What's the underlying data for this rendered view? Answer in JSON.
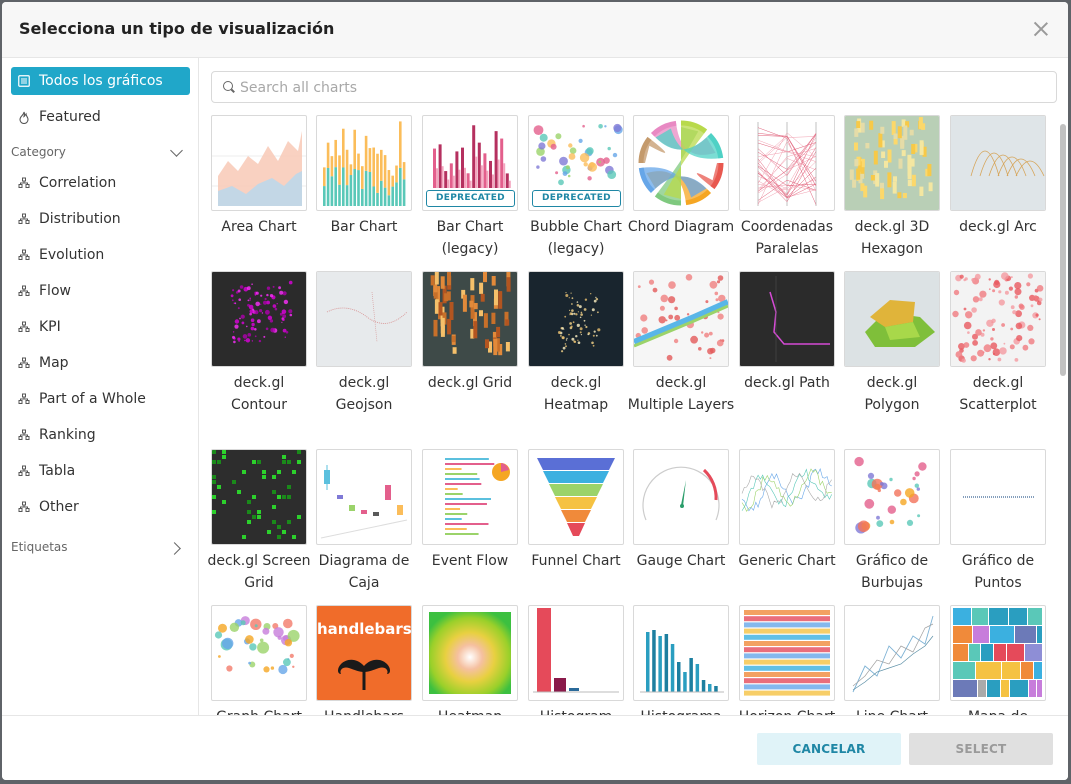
{
  "modal": {
    "title": "Selecciona un tipo de visualización"
  },
  "sidebar": {
    "top_items": [
      {
        "label": "Todos los gráficos",
        "active": true,
        "icon": "list-icon"
      },
      {
        "label": "Featured",
        "active": false,
        "icon": "fire-icon"
      }
    ],
    "category_label": "Category",
    "categories": [
      "Correlation",
      "Distribution",
      "Evolution",
      "Flow",
      "KPI",
      "Map",
      "Part of a Whole",
      "Ranking",
      "Tabla",
      "Other"
    ],
    "tags_label": "Etiquetas"
  },
  "search": {
    "placeholder": "Search all charts",
    "value": ""
  },
  "charts": [
    {
      "label": "Area Chart"
    },
    {
      "label": "Bar Chart"
    },
    {
      "label": "Bar Chart (legacy)",
      "badge": "DEPRECATED"
    },
    {
      "label": "Bubble Chart (legacy)",
      "badge": "DEPRECATED"
    },
    {
      "label": "Chord Diagram"
    },
    {
      "label": "Coordenadas Paralelas"
    },
    {
      "label": "deck.gl 3D Hexagon"
    },
    {
      "label": "deck.gl Arc"
    },
    {
      "label": "deck.gl Contour"
    },
    {
      "label": "deck.gl Geojson"
    },
    {
      "label": "deck.gl Grid"
    },
    {
      "label": "deck.gl Heatmap"
    },
    {
      "label": "deck.gl Multiple Layers"
    },
    {
      "label": "deck.gl Path"
    },
    {
      "label": "deck.gl Polygon"
    },
    {
      "label": "deck.gl Scatterplot"
    },
    {
      "label": "deck.gl Screen Grid"
    },
    {
      "label": "Diagrama de Caja"
    },
    {
      "label": "Event Flow"
    },
    {
      "label": "Funnel Chart"
    },
    {
      "label": "Gauge Chart"
    },
    {
      "label": "Generic Chart"
    },
    {
      "label": "Gráfico de Burbujas"
    },
    {
      "label": "Gráfico de Puntos"
    },
    {
      "label": "Graph Chart"
    },
    {
      "label": "Handlebars"
    },
    {
      "label": "Heatmap"
    },
    {
      "label": "Histogram"
    },
    {
      "label": "Histograma"
    },
    {
      "label": "Horizon Chart"
    },
    {
      "label": "Line Chart"
    },
    {
      "label": "Mapa de"
    }
  ],
  "thumb_text": {
    "handlebars": "handlebars"
  },
  "footer": {
    "cancel_label": "CANCELAR",
    "select_label": "SELECT"
  },
  "colors": {
    "accent": "#20a7c9",
    "deprecated": "#1f87a5"
  }
}
